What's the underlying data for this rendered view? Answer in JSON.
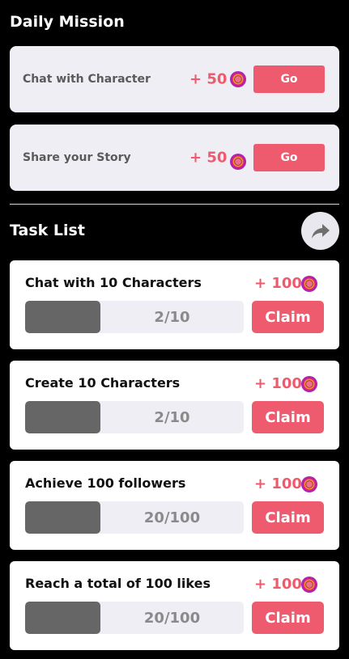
{
  "daily_mission": {
    "title": "Daily Mission",
    "items": [
      {
        "label": "Chat with Character",
        "reward": "+ 50",
        "button": "Go"
      },
      {
        "label": "Share your Story",
        "reward": "+ 50",
        "button": "Go"
      }
    ]
  },
  "task_list": {
    "title": "Task List",
    "share_icon": "share-arrow-icon",
    "items": [
      {
        "title": "Chat with 10 Characters",
        "reward": "+ 100",
        "progress": "2/10",
        "progress_fraction": 0.2,
        "button": "Claim"
      },
      {
        "title": "Create 10 Characters",
        "reward": "+ 100",
        "progress": "2/10",
        "progress_fraction": 0.2,
        "button": "Claim"
      },
      {
        "title": "Achieve 100 followers",
        "reward": "+ 100",
        "progress": "20/100",
        "progress_fraction": 0.2,
        "button": "Claim"
      },
      {
        "title": "Reach a total of 100 likes",
        "reward": "+ 100",
        "progress": "20/100",
        "progress_fraction": 0.2,
        "button": "Claim"
      }
    ]
  },
  "colors": {
    "accent": "#ee5a6e",
    "background": "#000000",
    "card": "#ffffff",
    "mission_card": "#efeef4",
    "progress_fill": "#666666"
  },
  "icons": {
    "coin": "coin-icon"
  }
}
